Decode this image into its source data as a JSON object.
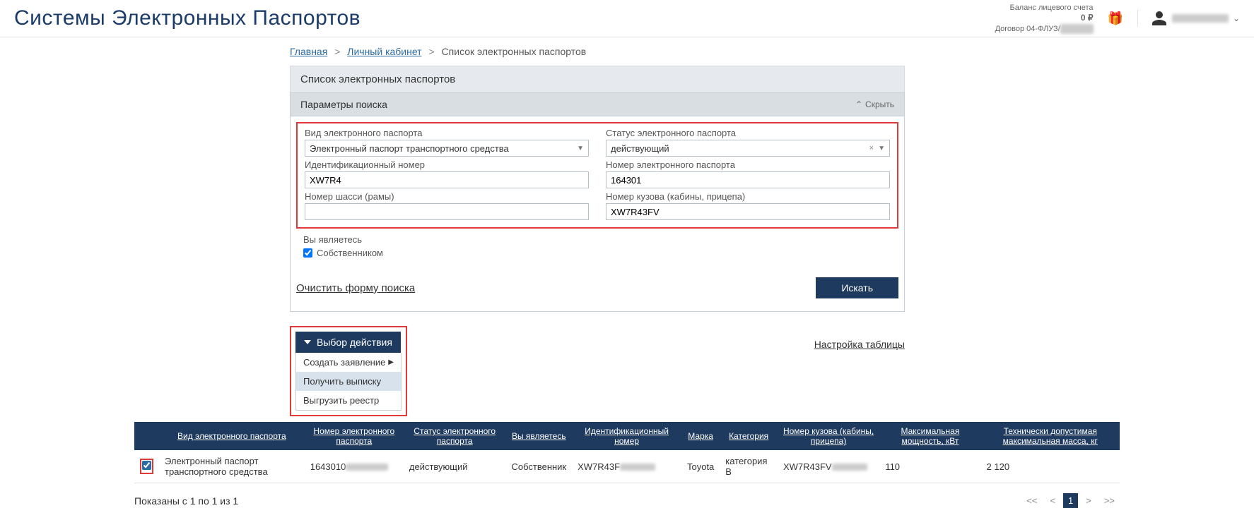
{
  "header": {
    "site_title": "Системы Электронных Паспортов",
    "balance_label": "Баланс лицевого счета",
    "balance_value": "0 ₽",
    "contract_prefix": "Договор 04-ФЛУЗ/",
    "contract_blur": "██████"
  },
  "breadcrumbs": {
    "home": "Главная",
    "cabinet": "Личный кабинет",
    "current": "Список электронных паспортов"
  },
  "panel": {
    "title": "Список электронных паспортов",
    "filter_title": "Параметры поиска",
    "collapse": "Скрыть"
  },
  "form": {
    "type_label": "Вид электронного паспорта",
    "type_value": "Электронный паспорт транспортного средства",
    "status_label": "Статус электронного паспорта",
    "status_value": "действующий",
    "idnum_label": "Идентификационный номер",
    "idnum_value": "XW7R4",
    "passnum_label": "Номер электронного паспорта",
    "passnum_value": "164301",
    "chassis_label": "Номер шасси (рамы)",
    "chassis_value": "",
    "body_label": "Номер кузова (кабины, прицепа)",
    "body_value": "XW7R43FV",
    "you_are_label": "Вы являетесь",
    "owner_label": "Собственником"
  },
  "buttons": {
    "clear": "Очистить форму поиска",
    "search": "Искать"
  },
  "actions": {
    "trigger": "Выбор действия",
    "items": [
      "Создать заявление",
      "Получить выписку",
      "Выгрузить реестр"
    ],
    "table_settings": "Настройка таблицы"
  },
  "table": {
    "headers": [
      "Вид электронного паспорта",
      "Номер электронного паспорта",
      "Статус электронного паспорта",
      "Вы являетесь",
      "Идентификационный номер",
      "Марка",
      "Категория",
      "Номер кузова (кабины, прицепа)",
      "Максимальная мощность, кВт",
      "Технически допустимая максимальная масса, кг"
    ],
    "row": {
      "type": "Электронный паспорт транспортного средства",
      "passnum": "1643010",
      "status": "действующий",
      "you": "Собственник",
      "idnum": "XW7R43F",
      "make": "Toyota",
      "category": "категория B",
      "bodynum": "XW7R43FV",
      "power": "110",
      "mass": "2 120"
    }
  },
  "pager": {
    "summary": "Показаны с 1 по 1 из 1",
    "first": "<<",
    "prev": "<",
    "page": "1",
    "next": ">",
    "last": ">>"
  }
}
